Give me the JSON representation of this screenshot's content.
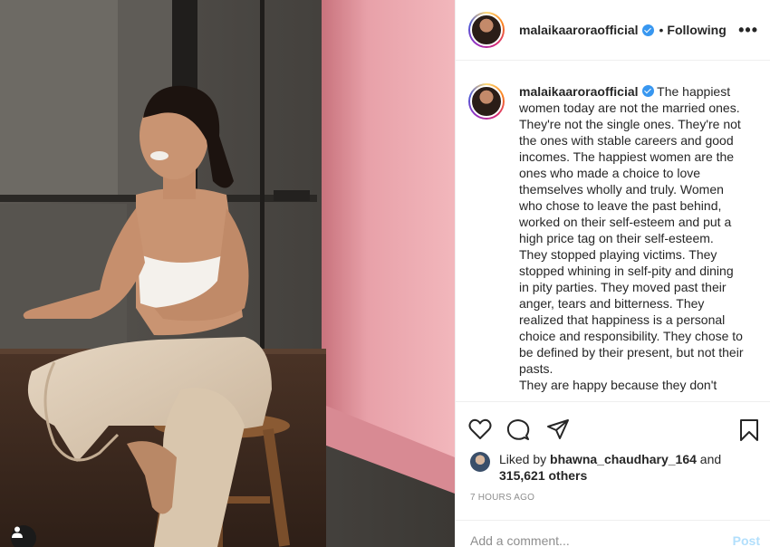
{
  "post": {
    "username": "malaikaaroraofficial",
    "verified": true,
    "separator": "•",
    "follow_status": "Following",
    "more_icon": "more-horizontal-icon",
    "more_label": "•••",
    "caption_lines": [
      "The happiest women today are not the married ones. They're not the single ones. They're not the ones with stable careers and good incomes. The happiest women are the ones who made a choice to love themselves wholly and truly. Women who chose to leave the past behind, worked on their self-esteem and put a high price tag on their self-esteem.",
      "They stopped playing victims. They stopped whining in self-pity and dining in pity parties. They moved past their anger, tears and bitterness. They realized that happiness is a personal choice and responsibility. They chose to be defined by their present, but not their pasts.",
      "They are happy because they don't"
    ],
    "liked_by_prefix": "Liked by ",
    "liked_by_user": "bhawna_chaudhary_164",
    "liked_by_and": " and",
    "likes_others": "315,621 others",
    "timestamp": "7 HOURS AGO",
    "comment_placeholder": "Add a comment...",
    "post_button": "Post"
  },
  "icons": {
    "like": "heart-icon",
    "comment": "comment-bubble-icon",
    "share": "paper-plane-icon",
    "save": "bookmark-icon",
    "tag": "user-tag-icon"
  },
  "colors": {
    "verified": "#3897f0",
    "text": "#262626",
    "muted": "#8e8e8e",
    "post_disabled": "#b2dffc",
    "backdrop_pink": "#e79aa3"
  }
}
